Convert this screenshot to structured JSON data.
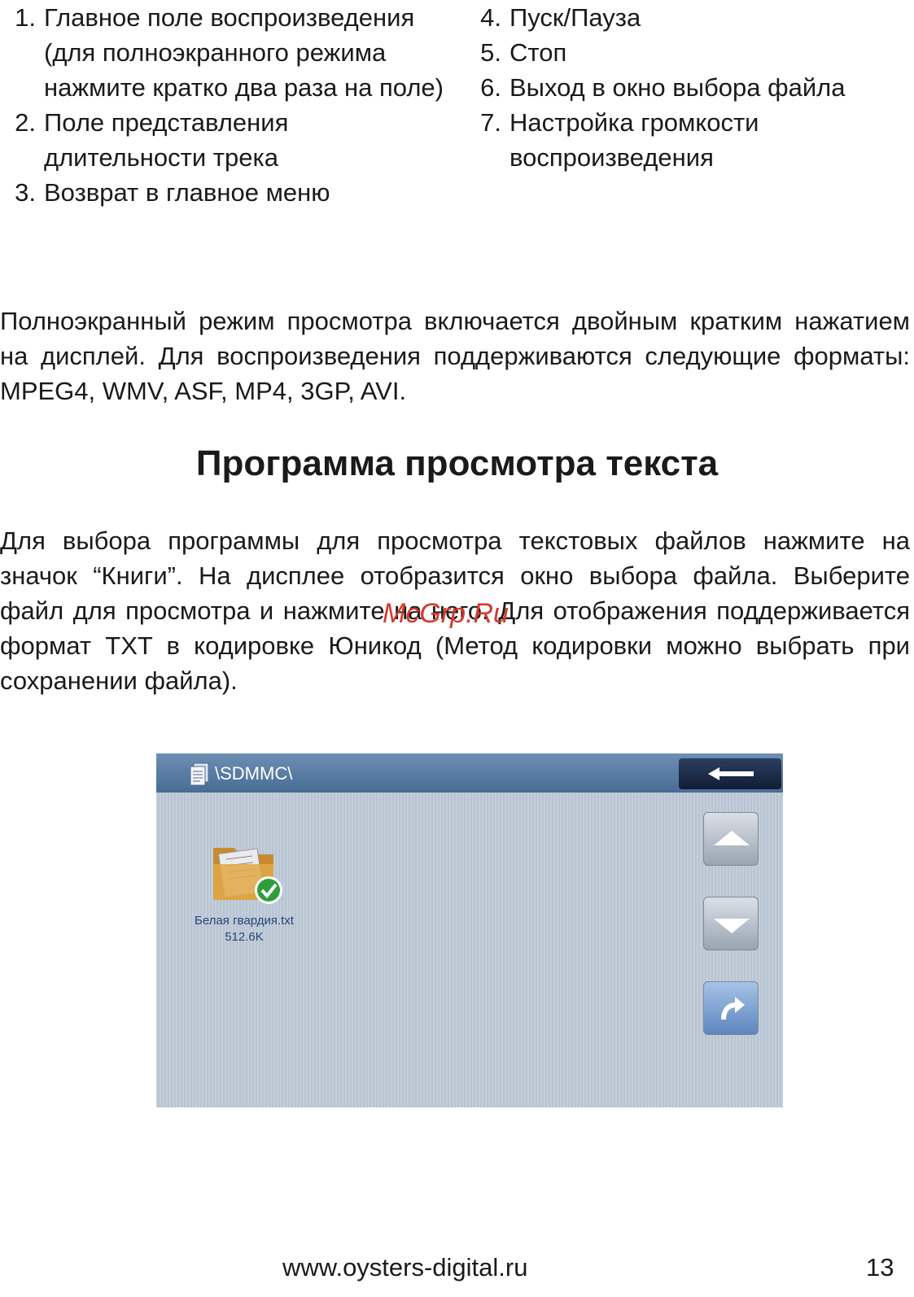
{
  "list_left": [
    {
      "num": "1.",
      "text": "Главное поле воспроизведения (для полноэкранного режима нажмите кратко два раза на поле)"
    },
    {
      "num": "2.",
      "text": "Поле представления длительности трека"
    },
    {
      "num": "3.",
      "text": "Возврат в главное меню"
    }
  ],
  "list_right": [
    {
      "num": "4.",
      "text": "Пуск/Пауза"
    },
    {
      "num": "5.",
      "text": "Стоп"
    },
    {
      "num": "6.",
      "text": "Выход в окно выбора файла"
    },
    {
      "num": "7.",
      "text": "Настройка громкости воспроизведения"
    }
  ],
  "paragraph1": "Полноэкранный режим просмотра включается двойным кратким нажатием на дисплей. Для воспроизведения поддерживаются следующие форматы: MPEG4, WMV, ASF, MP4, 3GP, AVI.",
  "heading": "Программа просмотра текста",
  "paragraph2": "Для выбора программы для просмотра текстовых файлов нажмите на значок “Книги”. На дисплее отобразится окно выбора файла. Выберите файл для просмотра и нажмите на него.  Для отображения поддерживается формат TXT в кодировке Юникод (Метод кодировки можно выбрать при сохранении файла).",
  "watermark": "McGrp.Ru",
  "screen": {
    "path": "\\SDMMC\\",
    "file": {
      "name": "Белая гвардия.txt",
      "size": "512.6K"
    },
    "icons": {
      "title": "documents-icon",
      "back": "arrow-left-icon",
      "up": "triangle-up-icon",
      "down": "triangle-down-icon",
      "enter": "curved-arrow-icon",
      "file": "folder-check-icon"
    },
    "colors": {
      "titlebar": "#486c95",
      "background": "#c3cedb",
      "back_button": "#111c31",
      "check": "#2e9e3a"
    }
  },
  "footer": {
    "url": "www.oysters-digital.ru",
    "page": "13"
  }
}
